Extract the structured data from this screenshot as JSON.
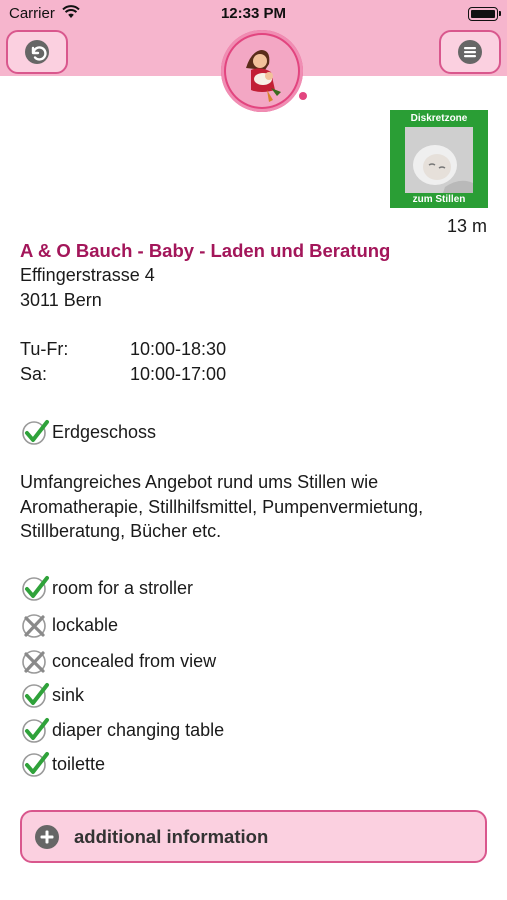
{
  "status_bar": {
    "carrier": "Carrier",
    "time": "12:33 PM"
  },
  "header": {
    "back_icon": "back-arrow-icon",
    "menu_icon": "menu-icon",
    "logo": "nursing-mother-logo"
  },
  "badge": {
    "top_text": "Diskretzone",
    "bottom_text": "zum Stillen"
  },
  "distance": "13 m",
  "place": {
    "name": "A & O Bauch - Baby - Laden und Beratung",
    "street": "Effingerstrasse 4",
    "city": "3011 Bern"
  },
  "hours": [
    {
      "day": "Tu-Fr:",
      "time": "10:00-18:30"
    },
    {
      "day": "Sa:",
      "time": "10:00-17:00"
    }
  ],
  "floor": {
    "label": "Erdgeschoss",
    "available": true
  },
  "description": "Umfangreiches Angebot rund ums Stillen wie Aromatherapie, Stillhilfsmittel, Pumpenvermietung, Stillberatung, Bücher etc.",
  "features": [
    {
      "label": "room for a stroller",
      "available": true
    },
    {
      "label": "lockable",
      "available": false
    },
    {
      "label": "concealed from view",
      "available": false
    },
    {
      "label": "sink",
      "available": true
    },
    {
      "label": "diaper changing table",
      "available": true
    },
    {
      "label": "toilette",
      "available": true
    }
  ],
  "more_button": {
    "label": "additional information",
    "icon": "plus-circle-icon"
  },
  "colors": {
    "accent": "#a3165a",
    "header": "#f6b5cd",
    "button_border": "#d9578d",
    "badge_green": "#2a9e35"
  }
}
